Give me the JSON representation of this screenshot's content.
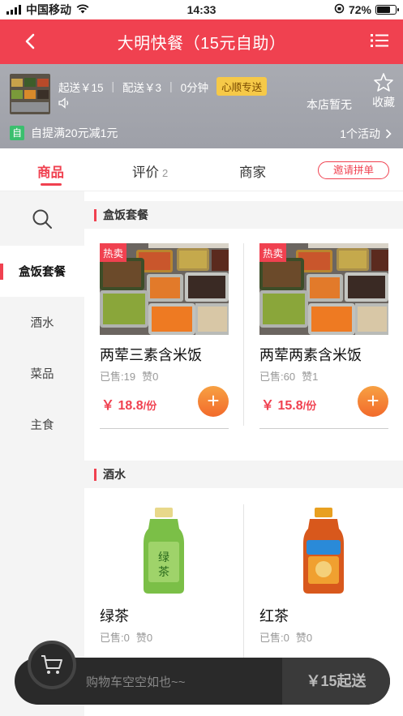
{
  "status_bar": {
    "carrier": "中国移动",
    "time": "14:33",
    "battery_label": "72%",
    "battery_level": 0.72
  },
  "header": {
    "title": "大明快餐（15元自助）",
    "back_icon": "chevron-left-icon",
    "menu_icon": "list-icon"
  },
  "store": {
    "min_order": "起送￥15",
    "delivery_fee": "配送￥3",
    "delivery_time": "0分钟",
    "badge": "心顺专送",
    "notice": "本店暂无",
    "favorite_label": "收藏",
    "promo_tag": "自",
    "promo_text": "自提满20元减1元",
    "activity_label": "1个活动"
  },
  "tabs": [
    {
      "label": "商品",
      "count": ""
    },
    {
      "label": "评价",
      "count": "2"
    },
    {
      "label": "商家",
      "count": ""
    }
  ],
  "invite_label": "邀请拼单",
  "categories": [
    "盒饭套餐",
    "酒水",
    "菜品",
    "主食"
  ],
  "sections": [
    {
      "title": "盒饭套餐",
      "items": [
        {
          "badge": "热卖",
          "name": "两荤三素含米饭",
          "sold": "已售:19",
          "likes": "赞0",
          "price": "￥ 18.8",
          "unit": "/份"
        },
        {
          "badge": "热卖",
          "name": "两荤两素含米饭",
          "sold": "已售:60",
          "likes": "赞1",
          "price": "￥ 15.8",
          "unit": "/份"
        }
      ]
    },
    {
      "title": "酒水",
      "items": [
        {
          "name": "绿茶",
          "sold": "已售:0",
          "likes": "赞0",
          "price": "",
          "unit": ""
        },
        {
          "name": "红茶",
          "sold": "已售:0",
          "likes": "赞0",
          "price": "",
          "unit": ""
        }
      ]
    }
  ],
  "cart": {
    "empty_text": "购物车空空如也~~",
    "min_order_button": "￥15起送",
    "icon": "shopping-cart-icon"
  },
  "colors": {
    "brand": "#f04150",
    "add_button": "#f26a2b",
    "green_tag": "#3bbf6e"
  }
}
